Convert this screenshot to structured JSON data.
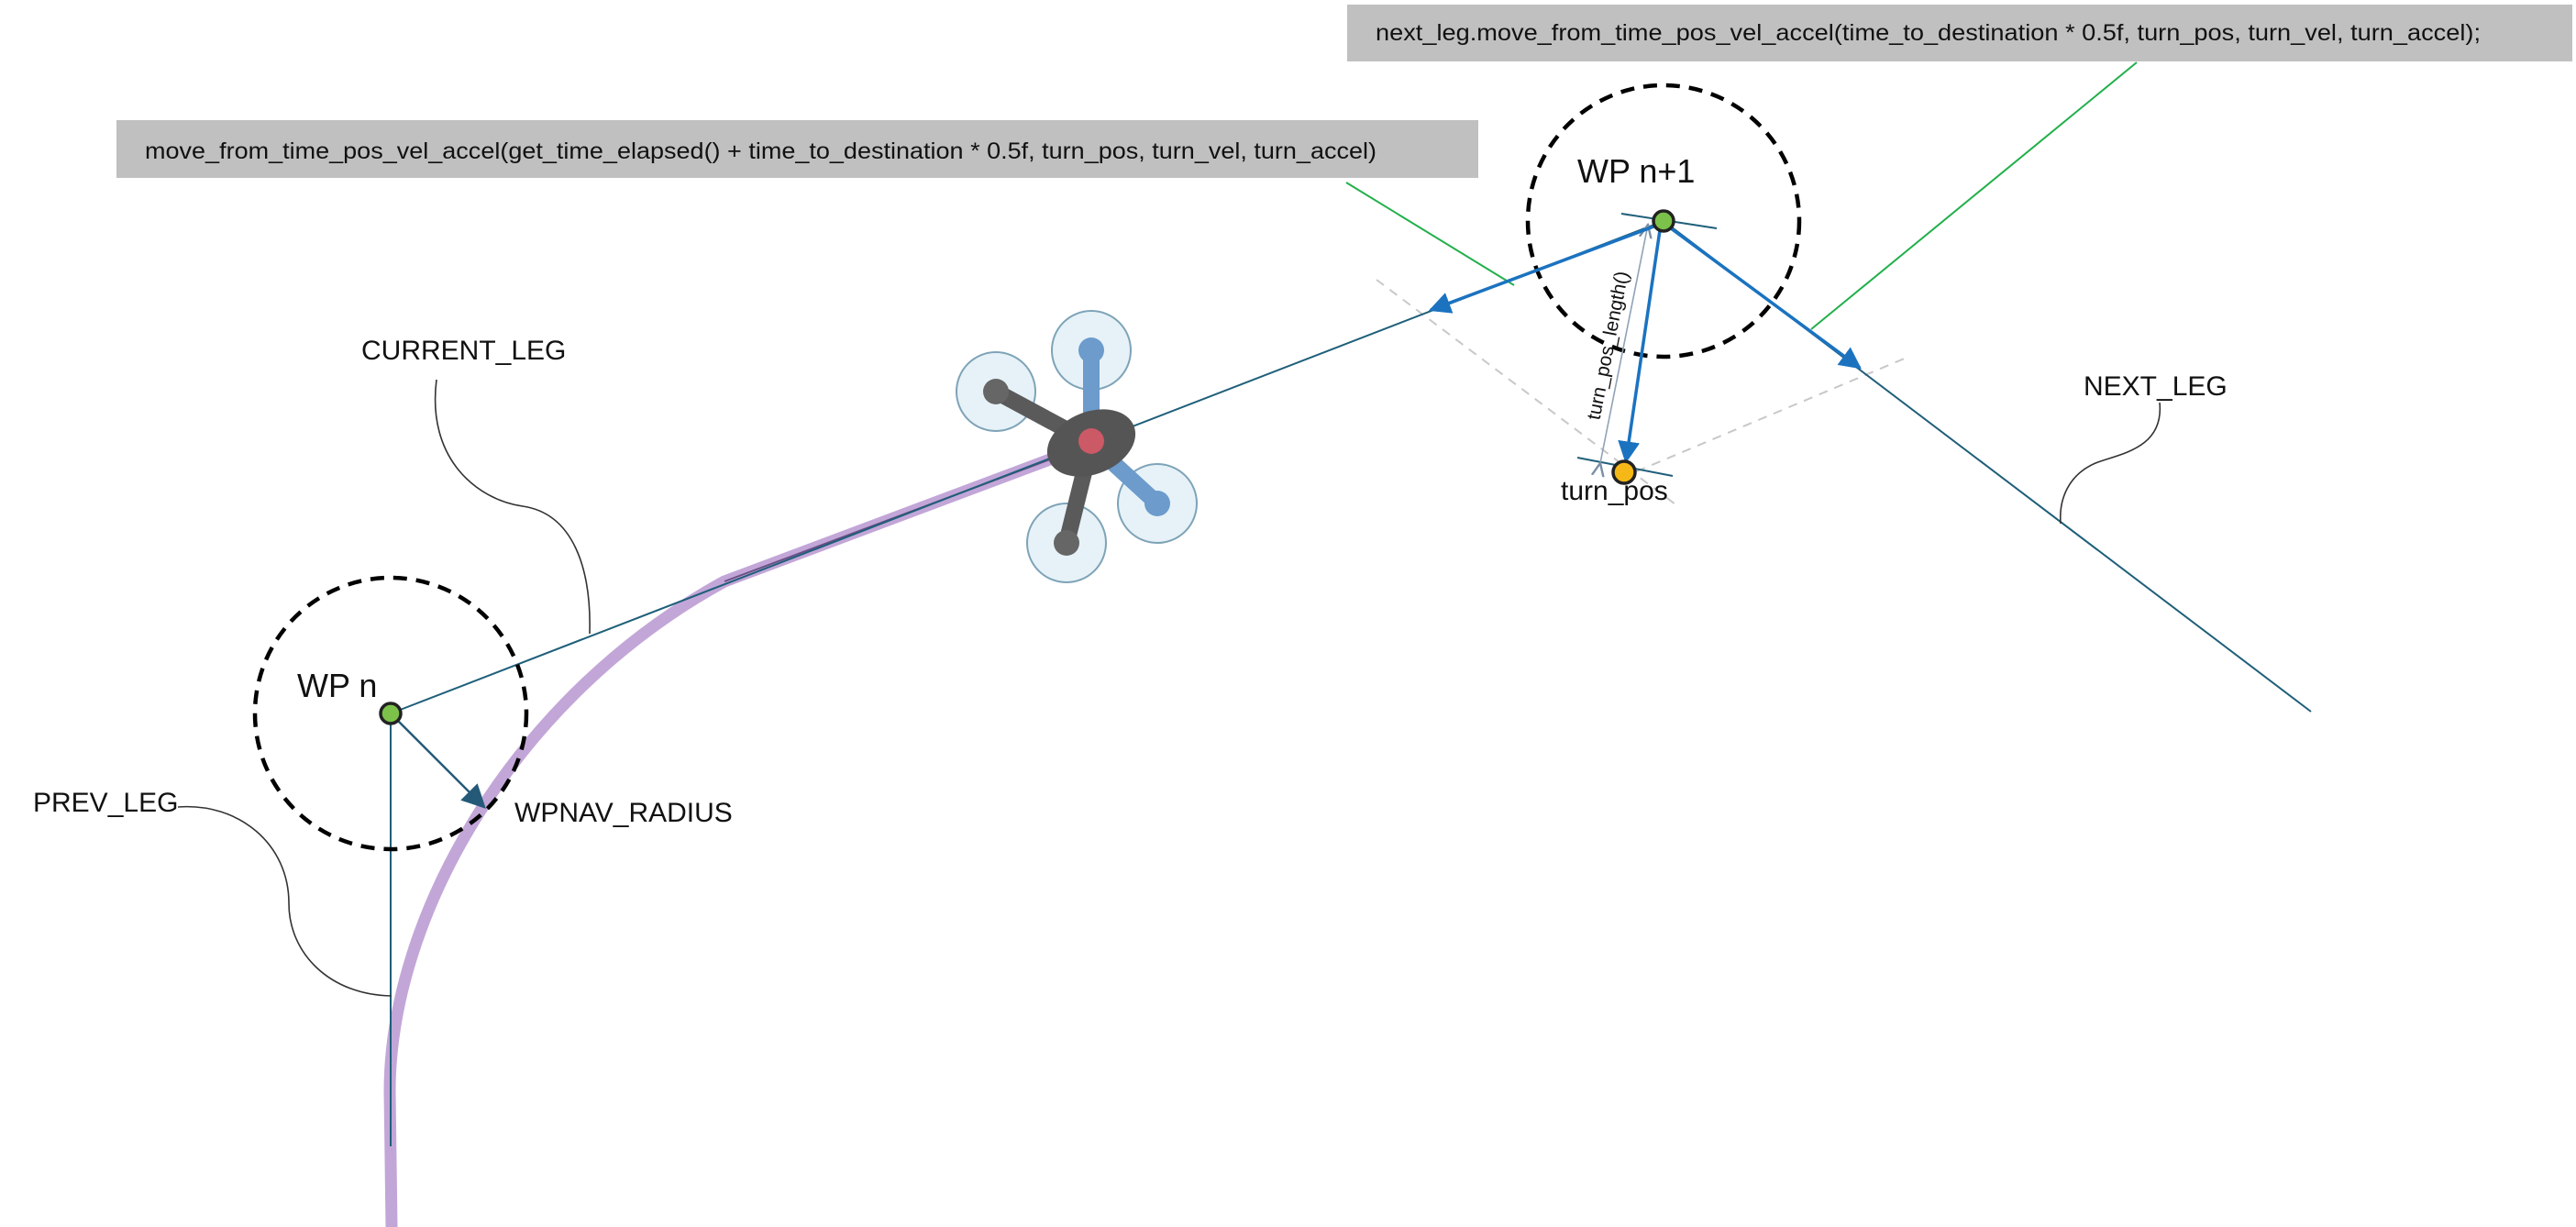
{
  "code_boxes": {
    "next_leg_call": "next_leg.move_from_time_pos_vel_accel(time_to_destination * 0.5f, turn_pos, turn_vel, turn_accel);",
    "current_leg_call": "move_from_time_pos_vel_accel(get_time_elapsed() + time_to_destination * 0.5f, turn_pos, turn_vel, turn_accel)"
  },
  "waypoints": {
    "wp_n": "WP n",
    "wp_n_plus_1": "WP n+1",
    "turn_pos": "turn_pos"
  },
  "legs": {
    "current": "CURRENT_LEG",
    "next": "NEXT_LEG",
    "prev": "PREV_LEG"
  },
  "annotations": {
    "wpnav_radius": "WPNAV_RADIUS",
    "turn_pos_length": "turn_pos_length()"
  },
  "icons": {
    "vehicle": "quadcopter-icon"
  },
  "colors": {
    "code_box": "#c0c0c0",
    "flight_path": "#c3a6d8",
    "leg_line": "#1f5f7a",
    "velocity_arrow": "#1b73c0",
    "callout_green": "#22b04b",
    "waypoint": "#7cc24a",
    "turn_pos": "#f5b817"
  }
}
